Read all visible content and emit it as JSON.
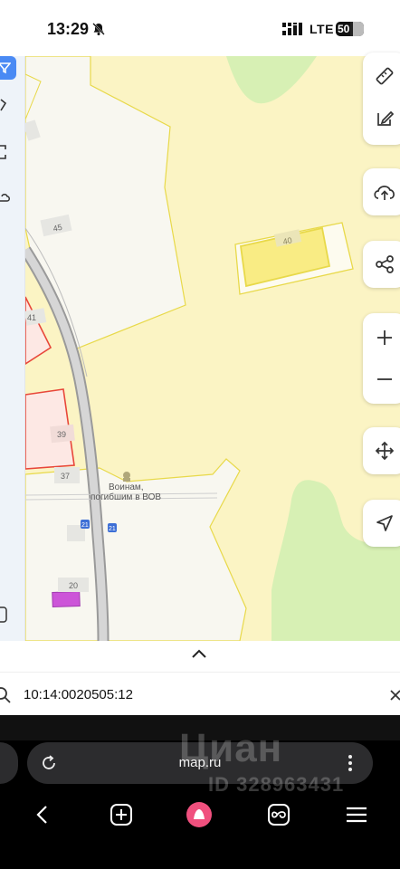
{
  "status_bar": {
    "time": "13:29",
    "network": "LTE",
    "battery": "50",
    "battery_fraction": 0.5
  },
  "map": {
    "building_numbers": [
      "45",
      "40",
      "41",
      "39",
      "37",
      "20",
      "21",
      "21"
    ],
    "monument_label_1": "Воинам,",
    "monument_label_2": "погибшим в ВОВ"
  },
  "map_controls": [
    "ruler-icon",
    "edit-icon",
    "cloud-upload-icon",
    "share-icon",
    "zoom-in-icon",
    "zoom-out-icon",
    "move-icon",
    "locate-icon"
  ],
  "search": {
    "value": "10:14:0020505:12"
  },
  "browser": {
    "url": "map.ru"
  },
  "watermark": {
    "logo": "Циан",
    "id": "ID 328963431"
  },
  "colors": {
    "parcel_fill": "#fbf4c4",
    "parcel_border": "#e8d94a",
    "forest": "#d7f0b4",
    "selected_building": "#f9ec84",
    "red_parcel": "#e8473a",
    "accent": "#4a8af4",
    "pink": "#cc55d8"
  }
}
